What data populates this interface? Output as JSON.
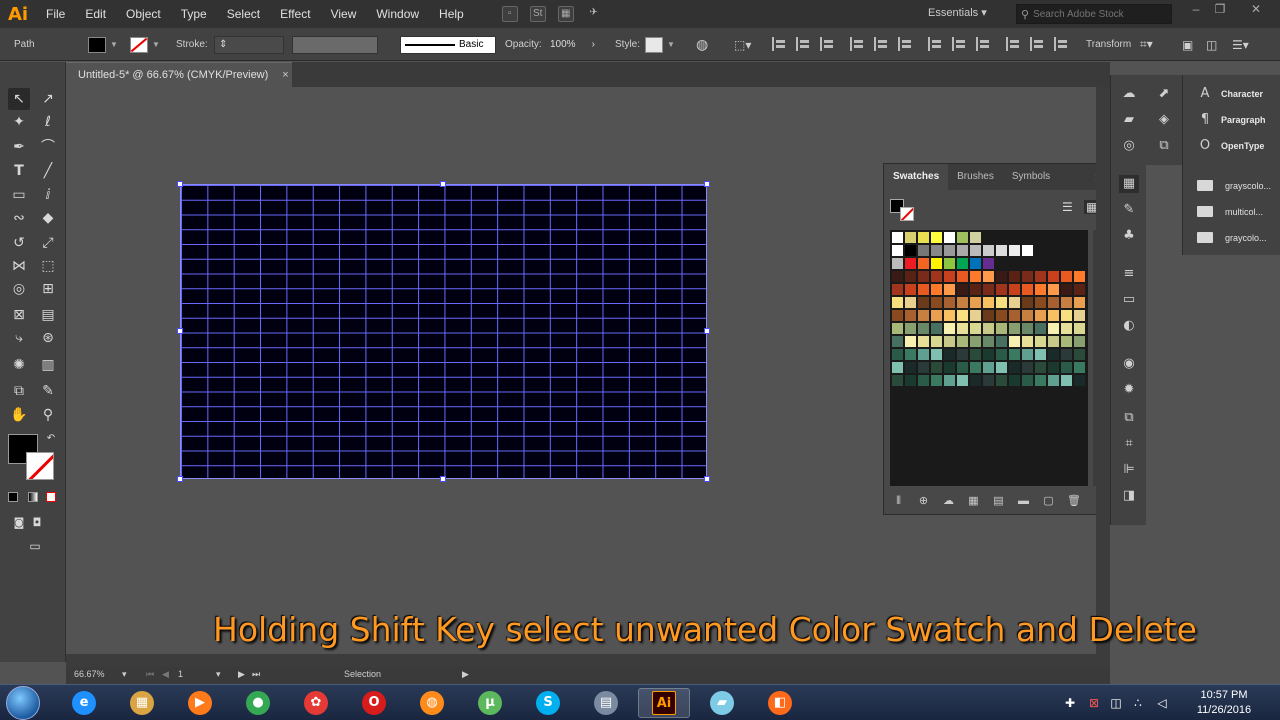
{
  "app": {
    "logo": "Ai"
  },
  "menu": [
    "File",
    "Edit",
    "Object",
    "Type",
    "Select",
    "Effect",
    "View",
    "Window",
    "Help"
  ],
  "menubar": {
    "workspace": "Essentials",
    "search_placeholder": "Search Adobe Stock"
  },
  "controlbar": {
    "selection_type": "Path",
    "stroke_label": "Stroke:",
    "stroke_style": "Basic",
    "opacity_label": "Opacity:",
    "opacity_value": "100%",
    "style_label": "Style:",
    "transform_label": "Transform"
  },
  "document": {
    "tab_title": "Untitled-5* @ 66.67% (CMYK/Preview)",
    "close_glyph": "×"
  },
  "swatches_panel": {
    "tabs": [
      "Swatches",
      "Brushes",
      "Symbols"
    ],
    "active_tab": 0,
    "colors": {
      "row_special": [
        "#ffffff",
        "#000000",
        "#777777",
        "#888888",
        "#999999",
        "#aaaaaa",
        "#bbbbbb",
        "#cccccc",
        "#dddddd",
        "#eeeeee",
        "#ffffff"
      ],
      "row_primary": [
        "#bbbbbb",
        "#ed1c24",
        "#f26522",
        "#fff200",
        "#8dc63f",
        "#00a651",
        "#0072bc",
        "#662d91"
      ],
      "warm_dark": [
        "#3a1a14",
        "#5a2214",
        "#7a2a18",
        "#a0341c",
        "#c8401c",
        "#e85a22",
        "#ff7a2a",
        "#ff9a4a"
      ],
      "earth": [
        "#6a3a1a",
        "#8a4a20",
        "#a86030",
        "#c88040",
        "#e8a050",
        "#f8c060",
        "#f8e080",
        "#e8d090"
      ],
      "yellowgreen": [
        "#f8f0b0",
        "#e8e098",
        "#d8d890",
        "#c8c888",
        "#a8b878",
        "#88a070",
        "#688868",
        "#487060"
      ],
      "deep": [
        "#2a4a3a",
        "#1a3a30",
        "#2a5a48",
        "#3a7a60",
        "#60a090",
        "#80c0b0",
        "#1a2a28",
        "#2a3a38"
      ]
    }
  },
  "dock": {
    "panels": [
      "Character",
      "Paragraph",
      "OpenType"
    ],
    "libraries": [
      "grayscolo...",
      "multicol...",
      "graycolo..."
    ]
  },
  "statusbar": {
    "zoom": "66.67%",
    "artboard": "1",
    "mode": "Selection"
  },
  "caption": "Holding Shift Key select unwanted Color Swatch and Delete",
  "taskbar": {
    "clock_time": "10:57 PM",
    "clock_date": "11/26/2016",
    "apps": [
      {
        "name": "ie",
        "glyph": "e",
        "color": "#1e90ff"
      },
      {
        "name": "explorer",
        "glyph": "▦",
        "color": "#d9a441"
      },
      {
        "name": "media",
        "glyph": "▶",
        "color": "#ff7a1a"
      },
      {
        "name": "chrome",
        "glyph": "●",
        "color": "#34a853"
      },
      {
        "name": "app5",
        "glyph": "✿",
        "color": "#e53935"
      },
      {
        "name": "opera",
        "glyph": "O",
        "color": "#d81b1b"
      },
      {
        "name": "firefox",
        "glyph": "◍",
        "color": "#ff8c1a"
      },
      {
        "name": "utorrent",
        "glyph": "µ",
        "color": "#5cb85c"
      },
      {
        "name": "skype",
        "glyph": "S",
        "color": "#00aff0"
      },
      {
        "name": "calculator",
        "glyph": "▤",
        "color": "#7a8aa0"
      },
      {
        "name": "illustrator",
        "glyph": "Ai",
        "color": "#330000"
      },
      {
        "name": "app12",
        "glyph": "▰",
        "color": "#7ecbe6"
      },
      {
        "name": "app13",
        "glyph": "◧",
        "color": "#ff6a1a"
      }
    ]
  }
}
